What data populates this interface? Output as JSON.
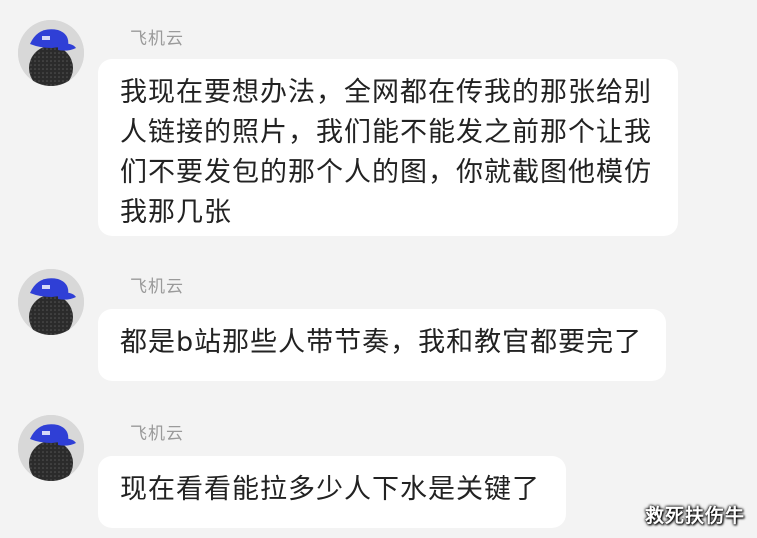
{
  "colors": {
    "background": "#f3f3f3",
    "bubble": "#ffffff",
    "sender_name": "#9a9a9a",
    "text": "#222222",
    "avatar_cap": "#2f3fd6"
  },
  "messages": [
    {
      "sender": "飞机云",
      "text": "我现在要想办法，全网都在传我的那张给别人链接的照片，我们能不能发之前那个让我们不要发包的那个人的图，你就截图他模仿我那几张",
      "avatar_icon": "blue-cap-penguin-avatar"
    },
    {
      "sender": "飞机云",
      "text": "都是b站那些人带节奏，我和教官都要完了",
      "avatar_icon": "blue-cap-penguin-avatar"
    },
    {
      "sender": "飞机云",
      "text": "现在看看能拉多少人下水是关键了",
      "avatar_icon": "blue-cap-penguin-avatar"
    }
  ],
  "watermark": "救死扶伤牛"
}
